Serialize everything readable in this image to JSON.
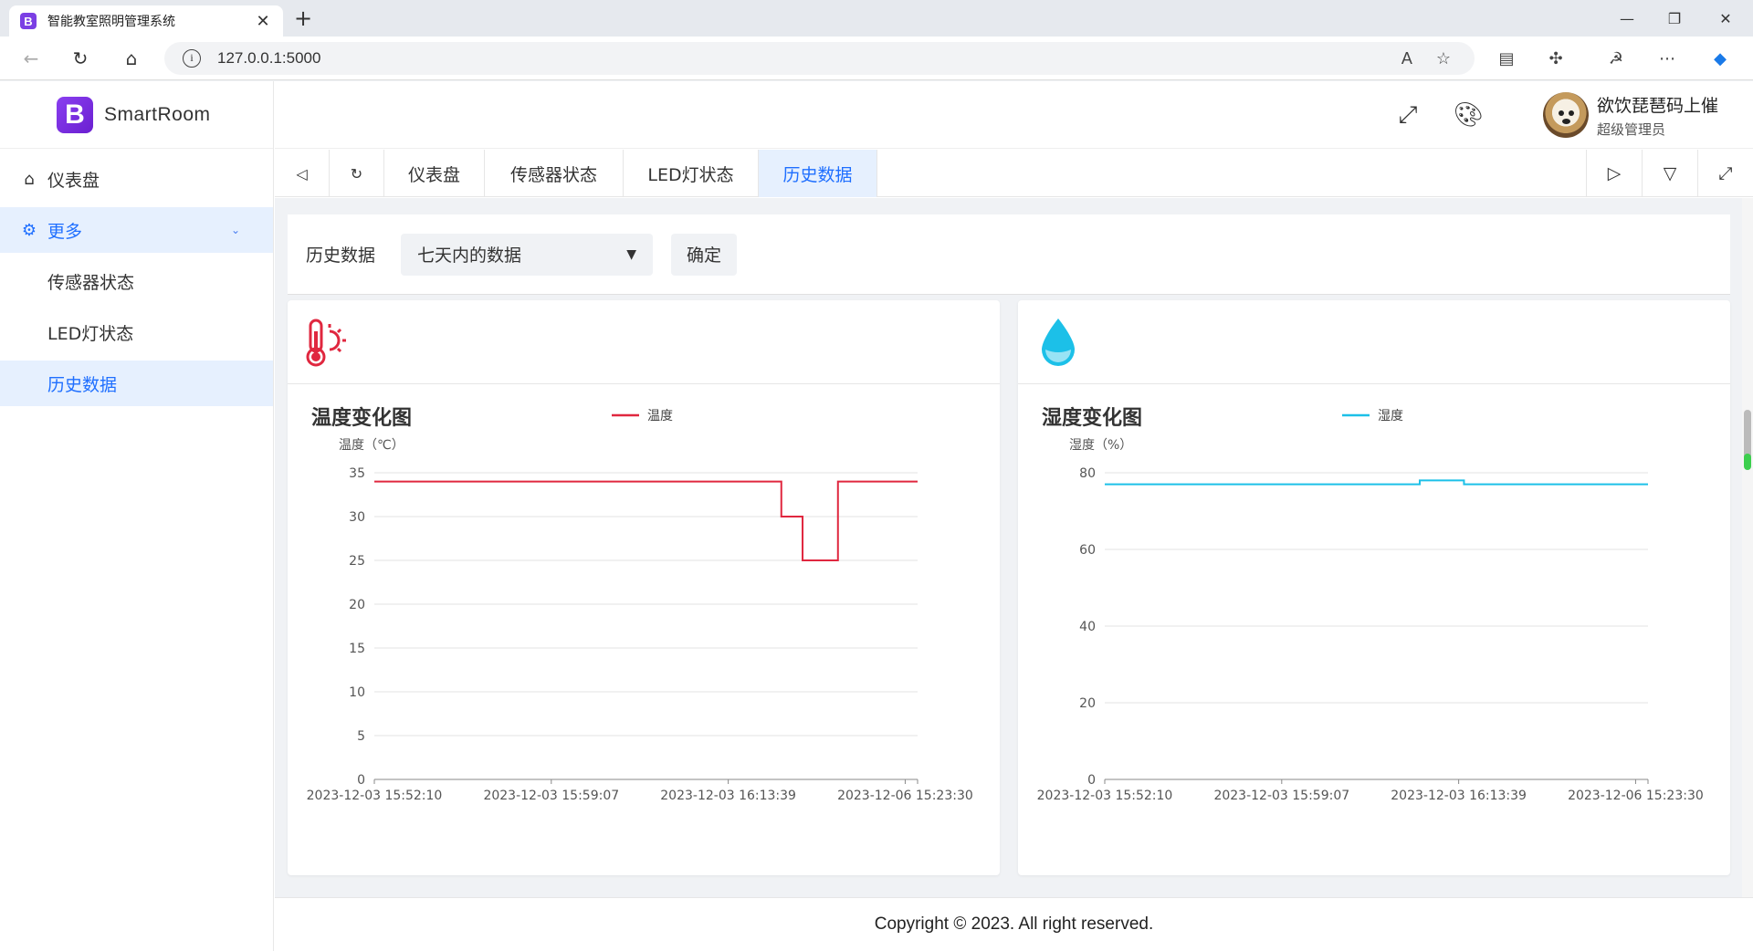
{
  "browser": {
    "tab_title": "智能教室照明管理系统",
    "favicon_letter": "B",
    "url": "127.0.0.1:5000",
    "window_controls": [
      "minimize",
      "restore",
      "close"
    ]
  },
  "app": {
    "logo_letter": "B",
    "logo_name": "SmartRoom",
    "user_name": "欲饮琵琶码上催",
    "user_role": "超级管理员"
  },
  "sidebar": {
    "items": [
      {
        "label": "仪表盘",
        "icon": "home-icon"
      },
      {
        "label": "更多",
        "icon": "gear-icon"
      }
    ],
    "sub_items": [
      {
        "label": "传感器状态"
      },
      {
        "label": "LED灯状态"
      },
      {
        "label": "历史数据"
      }
    ]
  },
  "tabs": {
    "items": [
      {
        "label": "仪表盘"
      },
      {
        "label": "传感器状态"
      },
      {
        "label": "LED灯状态"
      },
      {
        "label": "历史数据"
      }
    ],
    "active": "历史数据"
  },
  "filter": {
    "label": "历史数据",
    "selected": "七天内的数据",
    "confirm": "确定"
  },
  "footer": "Copyright © 2023. All right reserved.",
  "colors": {
    "accent": "#1f6fff",
    "temperature": "#e0273f",
    "humidity": "#1cc0e8"
  },
  "chart_data": [
    {
      "type": "line",
      "title": "温度变化图",
      "ylabel": "温度（℃）",
      "legend": "温度",
      "legend_position": "top",
      "ylim": [
        0,
        35
      ],
      "yticks": [
        0,
        5,
        10,
        15,
        20,
        25,
        30,
        35
      ],
      "xticks": [
        "2023-12-03 15:52:10",
        "2023-12-03 15:59:07",
        "2023-12-03 16:13:39",
        "2023-12-06 15:23:30"
      ],
      "series": [
        {
          "name": "温度",
          "points": [
            [
              0,
              34
            ],
            [
              2.3,
              34
            ],
            [
              2.3,
              30
            ],
            [
              2.42,
              30
            ],
            [
              2.42,
              25
            ],
            [
              2.62,
              25
            ],
            [
              2.62,
              34
            ],
            [
              3.07,
              34
            ]
          ]
        }
      ],
      "grid": true
    },
    {
      "type": "line",
      "title": "湿度变化图",
      "ylabel": "湿度（%）",
      "legend": "湿度",
      "legend_position": "top",
      "ylim": [
        0,
        80
      ],
      "yticks": [
        0,
        20,
        40,
        60,
        80
      ],
      "xticks": [
        "2023-12-03 15:52:10",
        "2023-12-03 15:59:07",
        "2023-12-03 16:13:39",
        "2023-12-06 15:23:30"
      ],
      "series": [
        {
          "name": "湿度",
          "points": [
            [
              0,
              77
            ],
            [
              1.78,
              77
            ],
            [
              1.78,
              78
            ],
            [
              2.03,
              78
            ],
            [
              2.03,
              77
            ],
            [
              3.07,
              77
            ]
          ]
        }
      ],
      "grid": true
    }
  ]
}
